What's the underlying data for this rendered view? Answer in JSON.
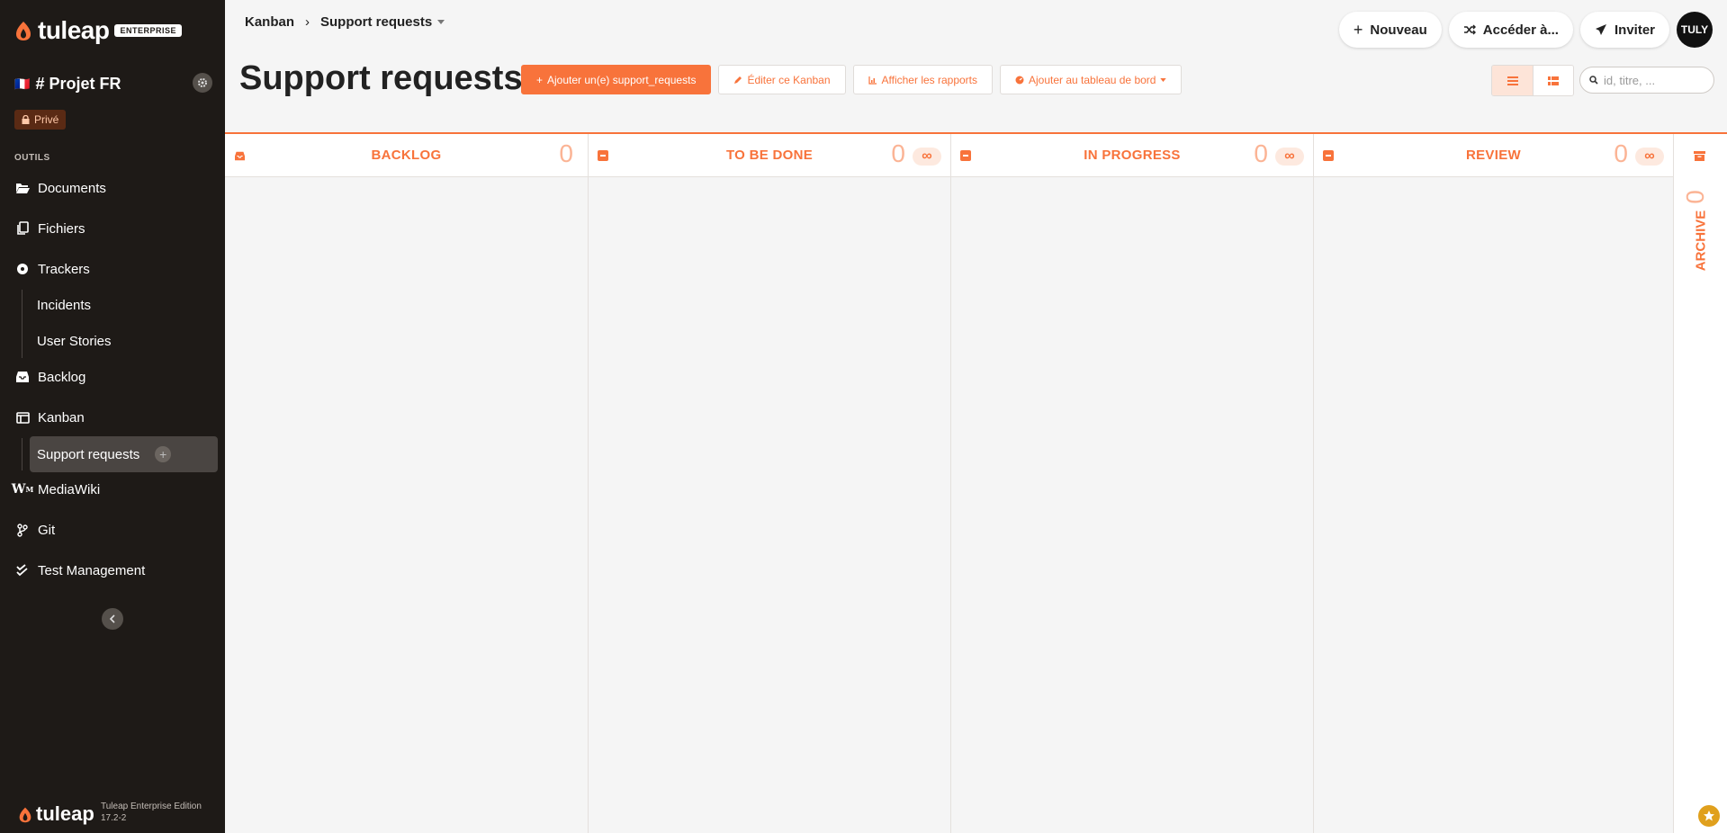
{
  "brand": {
    "name": "tuleap",
    "badge": "ENTERPRISE",
    "accent": "#f8733b",
    "sidebar_bg": "#1e1a17"
  },
  "project": {
    "flag": "🇫🇷",
    "name": "# Projet FR",
    "privacy": "Privé"
  },
  "sidebar": {
    "tools_label": "OUTILS",
    "items": [
      {
        "label": "Documents",
        "icon": "folder-open-icon"
      },
      {
        "label": "Fichiers",
        "icon": "files-icon"
      },
      {
        "label": "Trackers",
        "icon": "tracker-icon"
      },
      {
        "label": "Backlog",
        "icon": "inbox-icon"
      },
      {
        "label": "Kanban",
        "icon": "kanban-icon"
      },
      {
        "label": "MediaWiki",
        "icon": "mediawiki-icon"
      },
      {
        "label": "Git",
        "icon": "git-branch-icon"
      },
      {
        "label": "Test Management",
        "icon": "check-double-icon"
      }
    ],
    "tracker_subitems": [
      "Incidents",
      "User Stories"
    ],
    "kanban_subitems": [
      "Support requests"
    ],
    "footer_brand": "tuleap",
    "footer_edition": "Tuleap Enterprise Edition",
    "footer_version": "17.2-2"
  },
  "header": {
    "breadcrumb": [
      "Kanban",
      "Support requests"
    ],
    "actions": {
      "new": "Nouveau",
      "goto": "Accéder à...",
      "invite": "Inviter",
      "avatar": "TULY"
    }
  },
  "page": {
    "title": "Support requests",
    "toolbar": {
      "add": "Ajouter un(e) support_requests",
      "edit": "Éditer ce Kanban",
      "reports": "Afficher les rapports",
      "dashboard": "Ajouter au tableau de bord"
    },
    "search_placeholder": "id, titre, ..."
  },
  "board": {
    "columns": [
      {
        "label": "BACKLOG",
        "count": "0",
        "wip": ""
      },
      {
        "label": "TO BE DONE",
        "count": "0",
        "wip": "∞"
      },
      {
        "label": "IN PROGRESS",
        "count": "0",
        "wip": "∞"
      },
      {
        "label": "REVIEW",
        "count": "0",
        "wip": "∞"
      }
    ],
    "archive": {
      "label": "ARCHIVE",
      "count": "0"
    }
  }
}
